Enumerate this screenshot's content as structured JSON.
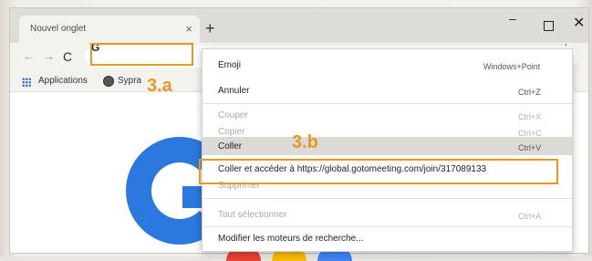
{
  "browser": {
    "tab_title": "Nouvel onglet",
    "tab_close": "×",
    "new_tab": "+",
    "window_controls": {
      "minimize": "–",
      "maximize": "",
      "close": "✕"
    },
    "nav": {
      "back": "←",
      "forward": "→",
      "reload": "C"
    },
    "omnibox_text": "G",
    "bookmarks": [
      {
        "label": "Applications",
        "icon": "apps-grid-icon"
      },
      {
        "label": "Sypra",
        "icon": "globe-icon"
      }
    ]
  },
  "context_menu": {
    "items": [
      {
        "label": "Emoji",
        "shortcut": "Windows+Point",
        "enabled": true
      },
      {
        "label": "Annuler",
        "shortcut": "Ctrl+Z",
        "enabled": true
      },
      {
        "label": "Couper",
        "shortcut": "Ctrl+X",
        "enabled": false
      },
      {
        "label": "Copier",
        "shortcut": "Ctrl+C",
        "enabled": false
      },
      {
        "label": "Coller",
        "shortcut": "Ctrl+V",
        "enabled": true
      },
      {
        "label": "Coller et accéder à https://global.gotomeeting.com/join/317089133",
        "shortcut": "",
        "enabled": true
      },
      {
        "label": "Supprimer",
        "shortcut": "",
        "enabled": false
      },
      {
        "label": "Tout sélectionner",
        "shortcut": "Ctrl+A",
        "enabled": false
      },
      {
        "label": "Modifier les moteurs de recherche...",
        "shortcut": "",
        "enabled": true
      }
    ]
  },
  "annotations": {
    "a": "3.a",
    "b": "3.b"
  },
  "colors": {
    "annotation": "#e69a26",
    "google_blue": "#2b78de"
  }
}
